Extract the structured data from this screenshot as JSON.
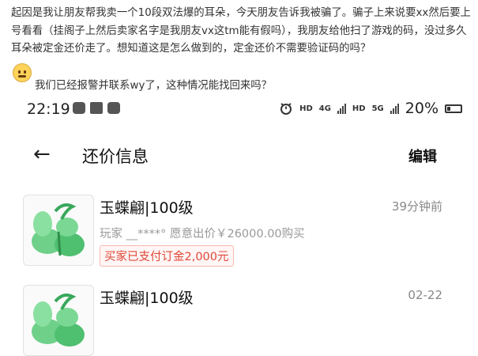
{
  "post": {
    "paragraph": "起因是我让朋友帮我卖一个10段双法爆的耳朵，今天朋友告诉我被骗了。骗子上来说要xx然后要上号看看（挂阁子上然后卖家名字是我朋友vx这tm能有假吗），我朋友给他扫了游戏的码，没过多久耳朵被定金还价走了。想知道这是怎么做到的，定金还价不需要验证码的吗？",
    "last_line": "我们已经报警并联系wy了，这种情况能找回来吗？"
  },
  "phone": {
    "status_bar": {
      "time": "22:19",
      "app_icons": [
        "paw-icon",
        "image-icon",
        "wechat-icon"
      ],
      "alarm_icon": "alarm-icon",
      "hd1": "HD",
      "net4g": "4G",
      "hd2": "HD",
      "net5g": "5G",
      "battery": "20%"
    },
    "nav": {
      "back_icon": "←",
      "title": "还价信息",
      "edit_label": "编辑"
    },
    "items": [
      {
        "name": "玉蝶翩|100级",
        "time": "39分钟前",
        "desc": "玩家 __****° 愿意出价￥26000.00购买",
        "badge": "买家已支付订金2,000元"
      },
      {
        "name": "玉蝶翩|100级",
        "time": "02-22"
      }
    ]
  },
  "colors": {
    "accent_red": "#e0483a",
    "gray_text": "#999999",
    "jade_green": "#5cc47a"
  }
}
